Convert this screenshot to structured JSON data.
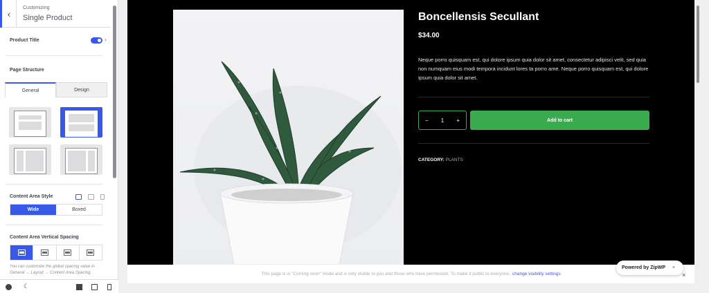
{
  "sidebar": {
    "header": {
      "subtitle": "Customizing",
      "title": "Single Product",
      "back_icon": "chevron-left"
    },
    "product_title_label": "Product Title",
    "product_title_enabled": true,
    "page_structure_label": "Page Structure",
    "tabs": [
      {
        "label": "General",
        "active": true
      },
      {
        "label": "Design",
        "active": false
      }
    ],
    "layout_options": [
      "layout-left-full",
      "layout-top-full",
      "layout-left-sidebar",
      "layout-right-sidebar"
    ],
    "selected_layout": 1,
    "content_area_style_label": "Content Area Style",
    "content_area_style_options": [
      "Wide",
      "Boxed"
    ],
    "content_area_style_selected": "Wide",
    "vertical_spacing_label": "Content Area Vertical Spacing",
    "help_text": "You can customize the global spacing value in General → Layout → Content Area Spacing."
  },
  "product": {
    "title": "Boncellensis Secullant",
    "price": "$34.00",
    "description": "Neque porro quisquam est, qui dolore ipsum quia dolor sit amet, consectetur adipisci velit, sed quia non numquam eius modi tempora incidunt lores ta porro ame. Neque porro quisquam est, qui dolore ipsum quia dolor sit amet.",
    "quantity": "1",
    "minus": "−",
    "plus": "+",
    "add_to_cart": "Add to cart",
    "category_label": "CATEGORY:",
    "category_value": "PLANTS"
  },
  "notice": {
    "text": "This page is in \"Coming soon\" mode and is only visible to you and those who have permission. To make it public to everyone,",
    "link": "change visibility settings",
    "close": "×"
  },
  "zipwp": {
    "label": "Powered by ZipWP",
    "close": "×"
  },
  "colors": {
    "accent": "#3858e9",
    "cart_green": "#3bab4f",
    "preview_bg": "#000000"
  }
}
